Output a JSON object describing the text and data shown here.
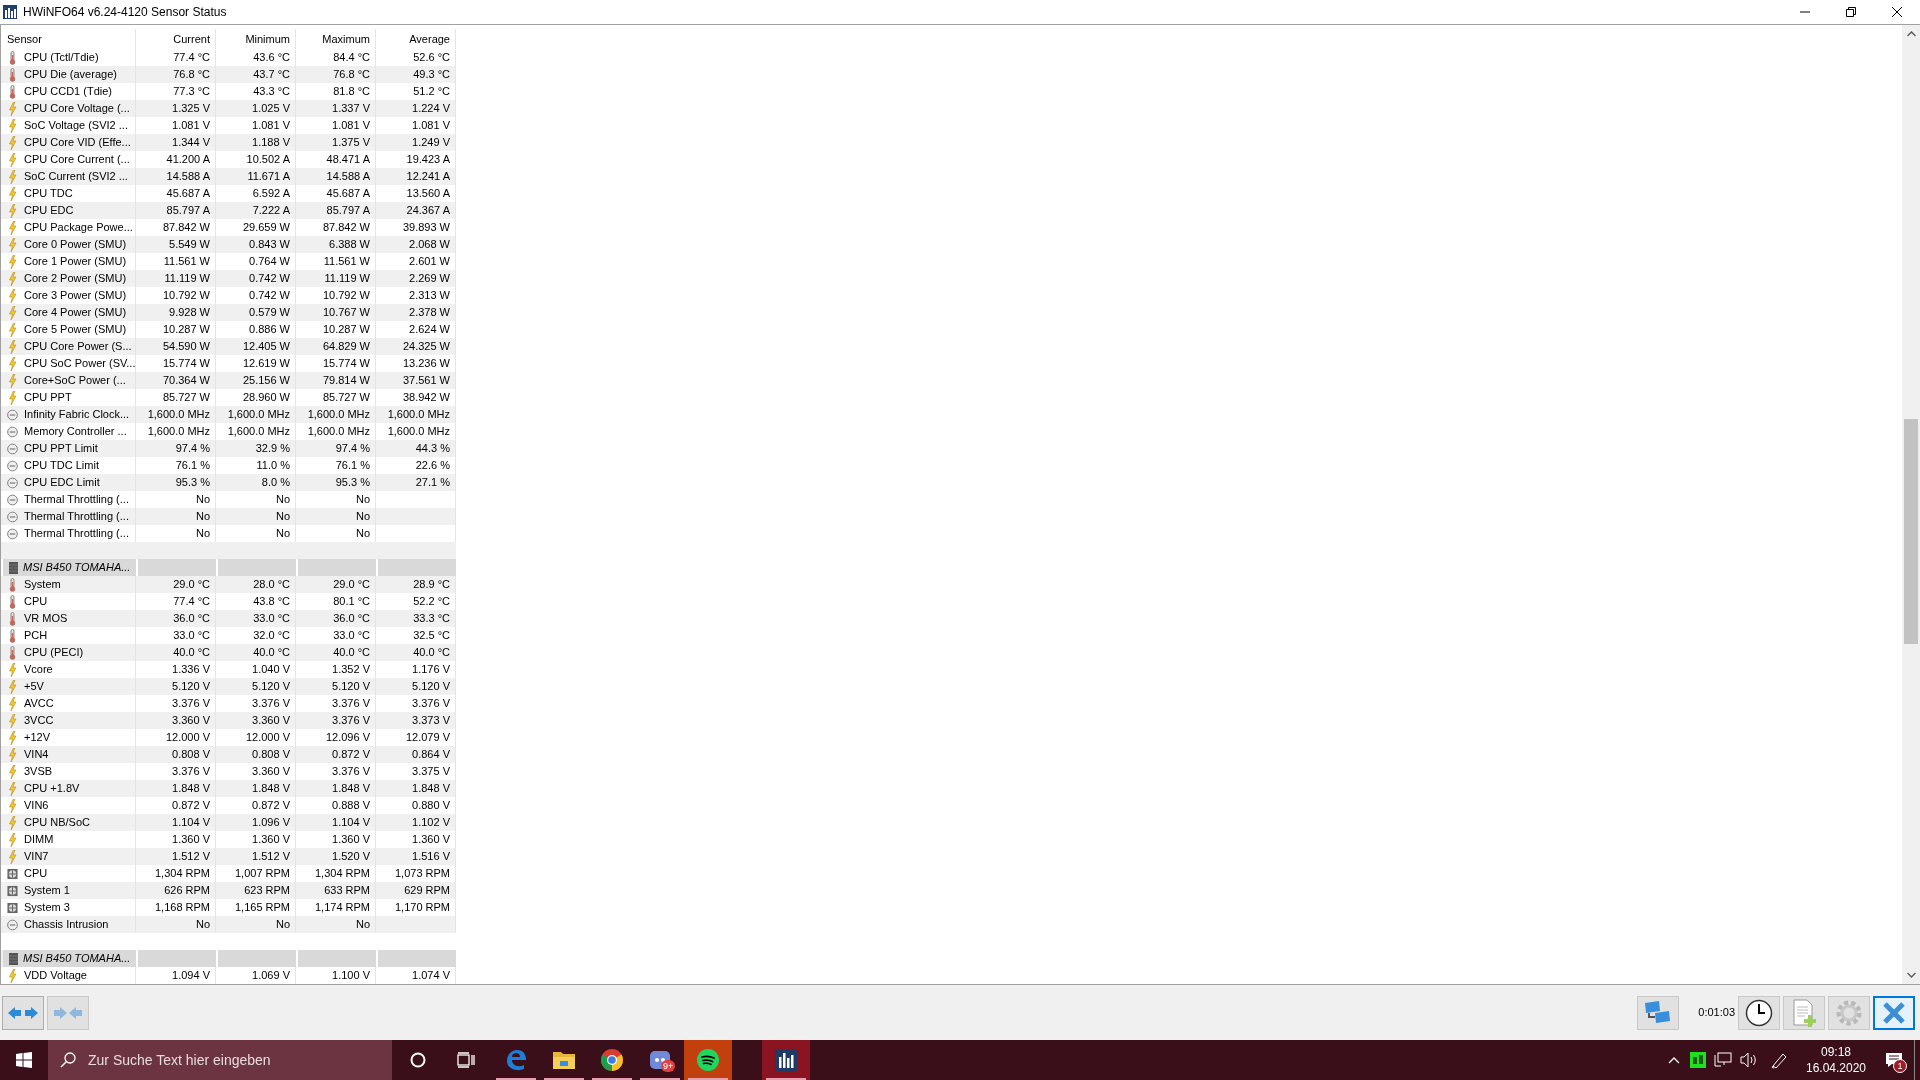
{
  "window": {
    "title": "HWiNFO64 v6.24-4120 Sensor Status"
  },
  "table": {
    "columns": [
      "Sensor",
      "Current",
      "Minimum",
      "Maximum",
      "Average"
    ],
    "sections": [
      {
        "rows": [
          {
            "kind": "thermometer",
            "name": "CPU (Tctl/Tdie)",
            "values": [
              "77.4 °C",
              "43.6 °C",
              "84.4 °C",
              "52.6 °C"
            ]
          },
          {
            "kind": "thermometer",
            "name": "CPU Die (average)",
            "values": [
              "76.8 °C",
              "43.7 °C",
              "76.8 °C",
              "49.3 °C"
            ]
          },
          {
            "kind": "thermometer",
            "name": "CPU CCD1 (Tdie)",
            "values": [
              "77.3 °C",
              "43.3 °C",
              "81.8 °C",
              "51.2 °C"
            ]
          },
          {
            "kind": "bolt",
            "name": "CPU Core Voltage (...",
            "values": [
              "1.325 V",
              "1.025 V",
              "1.337 V",
              "1.224 V"
            ]
          },
          {
            "kind": "bolt",
            "name": "SoC Voltage (SVI2 ...",
            "values": [
              "1.081 V",
              "1.081 V",
              "1.081 V",
              "1.081 V"
            ]
          },
          {
            "kind": "bolt",
            "name": "CPU Core VID (Effe...",
            "values": [
              "1.344 V",
              "1.188 V",
              "1.375 V",
              "1.249 V"
            ]
          },
          {
            "kind": "bolt",
            "name": "CPU Core Current (...",
            "values": [
              "41.200 A",
              "10.502 A",
              "48.471 A",
              "19.423 A"
            ]
          },
          {
            "kind": "bolt",
            "name": "SoC Current (SVI2 ...",
            "values": [
              "14.588 A",
              "11.671 A",
              "14.588 A",
              "12.241 A"
            ]
          },
          {
            "kind": "bolt",
            "name": "CPU TDC",
            "values": [
              "45.687 A",
              "6.592 A",
              "45.687 A",
              "13.560 A"
            ]
          },
          {
            "kind": "bolt",
            "name": "CPU EDC",
            "values": [
              "85.797 A",
              "7.222 A",
              "85.797 A",
              "24.367 A"
            ]
          },
          {
            "kind": "bolt",
            "name": "CPU Package Powe...",
            "values": [
              "87.842 W",
              "29.659 W",
              "87.842 W",
              "39.893 W"
            ]
          },
          {
            "kind": "bolt",
            "name": "Core 0 Power (SMU)",
            "values": [
              "5.549 W",
              "0.843 W",
              "6.388 W",
              "2.068 W"
            ]
          },
          {
            "kind": "bolt",
            "name": "Core 1 Power (SMU)",
            "values": [
              "11.561 W",
              "0.764 W",
              "11.561 W",
              "2.601 W"
            ]
          },
          {
            "kind": "bolt",
            "name": "Core 2 Power (SMU)",
            "values": [
              "11.119 W",
              "0.742 W",
              "11.119 W",
              "2.269 W"
            ]
          },
          {
            "kind": "bolt",
            "name": "Core 3 Power (SMU)",
            "values": [
              "10.792 W",
              "0.742 W",
              "10.792 W",
              "2.313 W"
            ]
          },
          {
            "kind": "bolt",
            "name": "Core 4 Power (SMU)",
            "values": [
              "9.928 W",
              "0.579 W",
              "10.767 W",
              "2.378 W"
            ]
          },
          {
            "kind": "bolt",
            "name": "Core 5 Power (SMU)",
            "values": [
              "10.287 W",
              "0.886 W",
              "10.287 W",
              "2.624 W"
            ]
          },
          {
            "kind": "bolt",
            "name": "CPU Core Power (S...",
            "values": [
              "54.590 W",
              "12.405 W",
              "64.829 W",
              "24.325 W"
            ]
          },
          {
            "kind": "bolt",
            "name": "CPU SoC Power (SV...",
            "values": [
              "15.774 W",
              "12.619 W",
              "15.774 W",
              "13.236 W"
            ]
          },
          {
            "kind": "bolt",
            "name": "Core+SoC Power (...",
            "values": [
              "70.364 W",
              "25.156 W",
              "79.814 W",
              "37.561 W"
            ]
          },
          {
            "kind": "bolt",
            "name": "CPU PPT",
            "values": [
              "85.727 W",
              "28.960 W",
              "85.727 W",
              "38.942 W"
            ]
          },
          {
            "kind": "gauge",
            "name": "Infinity Fabric Clock...",
            "values": [
              "1,600.0 MHz",
              "1,600.0 MHz",
              "1,600.0 MHz",
              "1,600.0 MHz"
            ]
          },
          {
            "kind": "gauge",
            "name": "Memory Controller ...",
            "values": [
              "1,600.0 MHz",
              "1,600.0 MHz",
              "1,600.0 MHz",
              "1,600.0 MHz"
            ]
          },
          {
            "kind": "gauge",
            "name": "CPU PPT Limit",
            "values": [
              "97.4 %",
              "32.9 %",
              "97.4 %",
              "44.3 %"
            ]
          },
          {
            "kind": "gauge",
            "name": "CPU TDC Limit",
            "values": [
              "76.1 %",
              "11.0 %",
              "76.1 %",
              "22.6 %"
            ]
          },
          {
            "kind": "gauge",
            "name": "CPU EDC Limit",
            "values": [
              "95.3 %",
              "8.0 %",
              "95.3 %",
              "27.1 %"
            ]
          },
          {
            "kind": "gauge",
            "name": "Thermal Throttling (...",
            "values": [
              "No",
              "No",
              "No"
            ]
          },
          {
            "kind": "gauge",
            "name": "Thermal Throttling (...",
            "values": [
              "No",
              "No",
              "No"
            ]
          },
          {
            "kind": "gauge",
            "name": "Thermal Throttling (...",
            "values": [
              "No",
              "No",
              "No"
            ]
          }
        ]
      },
      {
        "title": "MSI B450 TOMAHA...",
        "rows": [
          {
            "kind": "thermometer",
            "name": "System",
            "values": [
              "29.0 °C",
              "28.0 °C",
              "29.0 °C",
              "28.9 °C"
            ]
          },
          {
            "kind": "thermometer",
            "name": "CPU",
            "values": [
              "77.4 °C",
              "43.8 °C",
              "80.1 °C",
              "52.2 °C"
            ]
          },
          {
            "kind": "thermometer",
            "name": "VR MOS",
            "values": [
              "36.0 °C",
              "33.0 °C",
              "36.0 °C",
              "33.3 °C"
            ]
          },
          {
            "kind": "thermometer",
            "name": "PCH",
            "values": [
              "33.0 °C",
              "32.0 °C",
              "33.0 °C",
              "32.5 °C"
            ]
          },
          {
            "kind": "thermometer",
            "name": "CPU (PECI)",
            "values": [
              "40.0 °C",
              "40.0 °C",
              "40.0 °C",
              "40.0 °C"
            ]
          },
          {
            "kind": "bolt",
            "name": "Vcore",
            "values": [
              "1.336 V",
              "1.040 V",
              "1.352 V",
              "1.176 V"
            ]
          },
          {
            "kind": "bolt",
            "name": "+5V",
            "values": [
              "5.120 V",
              "5.120 V",
              "5.120 V",
              "5.120 V"
            ]
          },
          {
            "kind": "bolt",
            "name": "AVCC",
            "values": [
              "3.376 V",
              "3.376 V",
              "3.376 V",
              "3.376 V"
            ]
          },
          {
            "kind": "bolt",
            "name": "3VCC",
            "values": [
              "3.360 V",
              "3.360 V",
              "3.376 V",
              "3.373 V"
            ]
          },
          {
            "kind": "bolt",
            "name": "+12V",
            "values": [
              "12.000 V",
              "12.000 V",
              "12.096 V",
              "12.079 V"
            ]
          },
          {
            "kind": "bolt",
            "name": "VIN4",
            "values": [
              "0.808 V",
              "0.808 V",
              "0.872 V",
              "0.864 V"
            ]
          },
          {
            "kind": "bolt",
            "name": "3VSB",
            "values": [
              "3.376 V",
              "3.360 V",
              "3.376 V",
              "3.375 V"
            ]
          },
          {
            "kind": "bolt",
            "name": "CPU +1.8V",
            "values": [
              "1.848 V",
              "1.848 V",
              "1.848 V",
              "1.848 V"
            ]
          },
          {
            "kind": "bolt",
            "name": "VIN6",
            "values": [
              "0.872 V",
              "0.872 V",
              "0.888 V",
              "0.880 V"
            ]
          },
          {
            "kind": "bolt",
            "name": "CPU NB/SoC",
            "values": [
              "1.104 V",
              "1.096 V",
              "1.104 V",
              "1.102 V"
            ]
          },
          {
            "kind": "bolt",
            "name": "DIMM",
            "values": [
              "1.360 V",
              "1.360 V",
              "1.360 V",
              "1.360 V"
            ]
          },
          {
            "kind": "bolt",
            "name": "VIN7",
            "values": [
              "1.512 V",
              "1.512 V",
              "1.520 V",
              "1.516 V"
            ]
          },
          {
            "kind": "fan",
            "name": "CPU",
            "values": [
              "1,304 RPM",
              "1,007 RPM",
              "1,304 RPM",
              "1,073 RPM"
            ]
          },
          {
            "kind": "fan",
            "name": "System 1",
            "values": [
              "626 RPM",
              "623 RPM",
              "633 RPM",
              "629 RPM"
            ]
          },
          {
            "kind": "fan",
            "name": "System 3",
            "values": [
              "1,168 RPM",
              "1,165 RPM",
              "1,174 RPM",
              "1,170 RPM"
            ]
          },
          {
            "kind": "gauge",
            "name": "Chassis Intrusion",
            "values": [
              "No",
              "No",
              "No"
            ]
          }
        ]
      },
      {
        "title": "MSI B450 TOMAHA...",
        "rows": [
          {
            "kind": "bolt",
            "name": "VDD Voltage",
            "values": [
              "1.094 V",
              "1.069 V",
              "1.100 V",
              "1.074 V"
            ]
          }
        ]
      }
    ]
  },
  "toolbar": {
    "elapsed": "0:01:03"
  },
  "taskbar": {
    "search": {
      "placeholder": "Zur Suche Text hier eingeben"
    },
    "apps": [
      {
        "kind": "edge",
        "active": false
      },
      {
        "kind": "folder",
        "active": false
      },
      {
        "kind": "chrome",
        "active": false
      },
      {
        "kind": "discord",
        "active": false,
        "badge": "9+"
      },
      {
        "kind": "spotify",
        "active": true
      },
      {
        "kind": "hwinfo",
        "active": true
      }
    ],
    "time": "09:18",
    "date": "16.04.2020",
    "notification_badge": "1"
  }
}
